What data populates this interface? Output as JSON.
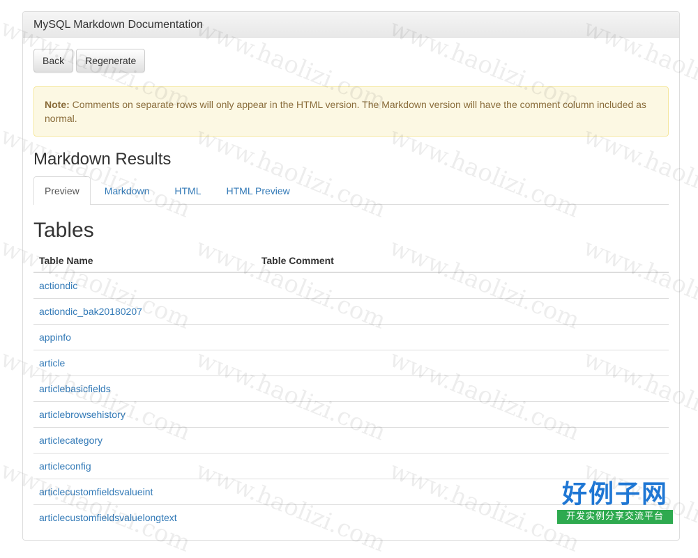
{
  "panel": {
    "title": "MySQL Markdown Documentation"
  },
  "toolbar": {
    "back_label": "Back",
    "regenerate_label": "Regenerate"
  },
  "alert": {
    "prefix": "Note:",
    "text": " Comments on separate rows will only appear in the HTML version. The Markdown version will have the comment column included as normal."
  },
  "results": {
    "heading": "Markdown Results"
  },
  "tabs": [
    {
      "label": "Preview",
      "active": true
    },
    {
      "label": "Markdown",
      "active": false
    },
    {
      "label": "HTML",
      "active": false
    },
    {
      "label": "HTML Preview",
      "active": false
    }
  ],
  "tables": {
    "heading": "Tables",
    "columns": [
      "Table Name",
      "Table Comment"
    ],
    "rows": [
      {
        "name": "actiondic",
        "comment": ""
      },
      {
        "name": "actiondic_bak20180207",
        "comment": ""
      },
      {
        "name": "appinfo",
        "comment": ""
      },
      {
        "name": "article",
        "comment": ""
      },
      {
        "name": "articlebasicfields",
        "comment": ""
      },
      {
        "name": "articlebrowsehistory",
        "comment": ""
      },
      {
        "name": "articlecategory",
        "comment": ""
      },
      {
        "name": "articleconfig",
        "comment": ""
      },
      {
        "name": "articlecustomfieldsvalueint",
        "comment": ""
      },
      {
        "name": "articlecustomfieldsvaluelongtext",
        "comment": ""
      }
    ]
  },
  "watermark": {
    "text": "www.haolizi.com"
  },
  "logo": {
    "main": "好例子网",
    "sub": "开发实例分享交流平台"
  },
  "colors": {
    "link": "#337ab7",
    "alert_bg": "#fcf8e3",
    "alert_text": "#8a6d3b",
    "logo_blue": "#1f77d4",
    "logo_green": "#2eaa4f"
  }
}
